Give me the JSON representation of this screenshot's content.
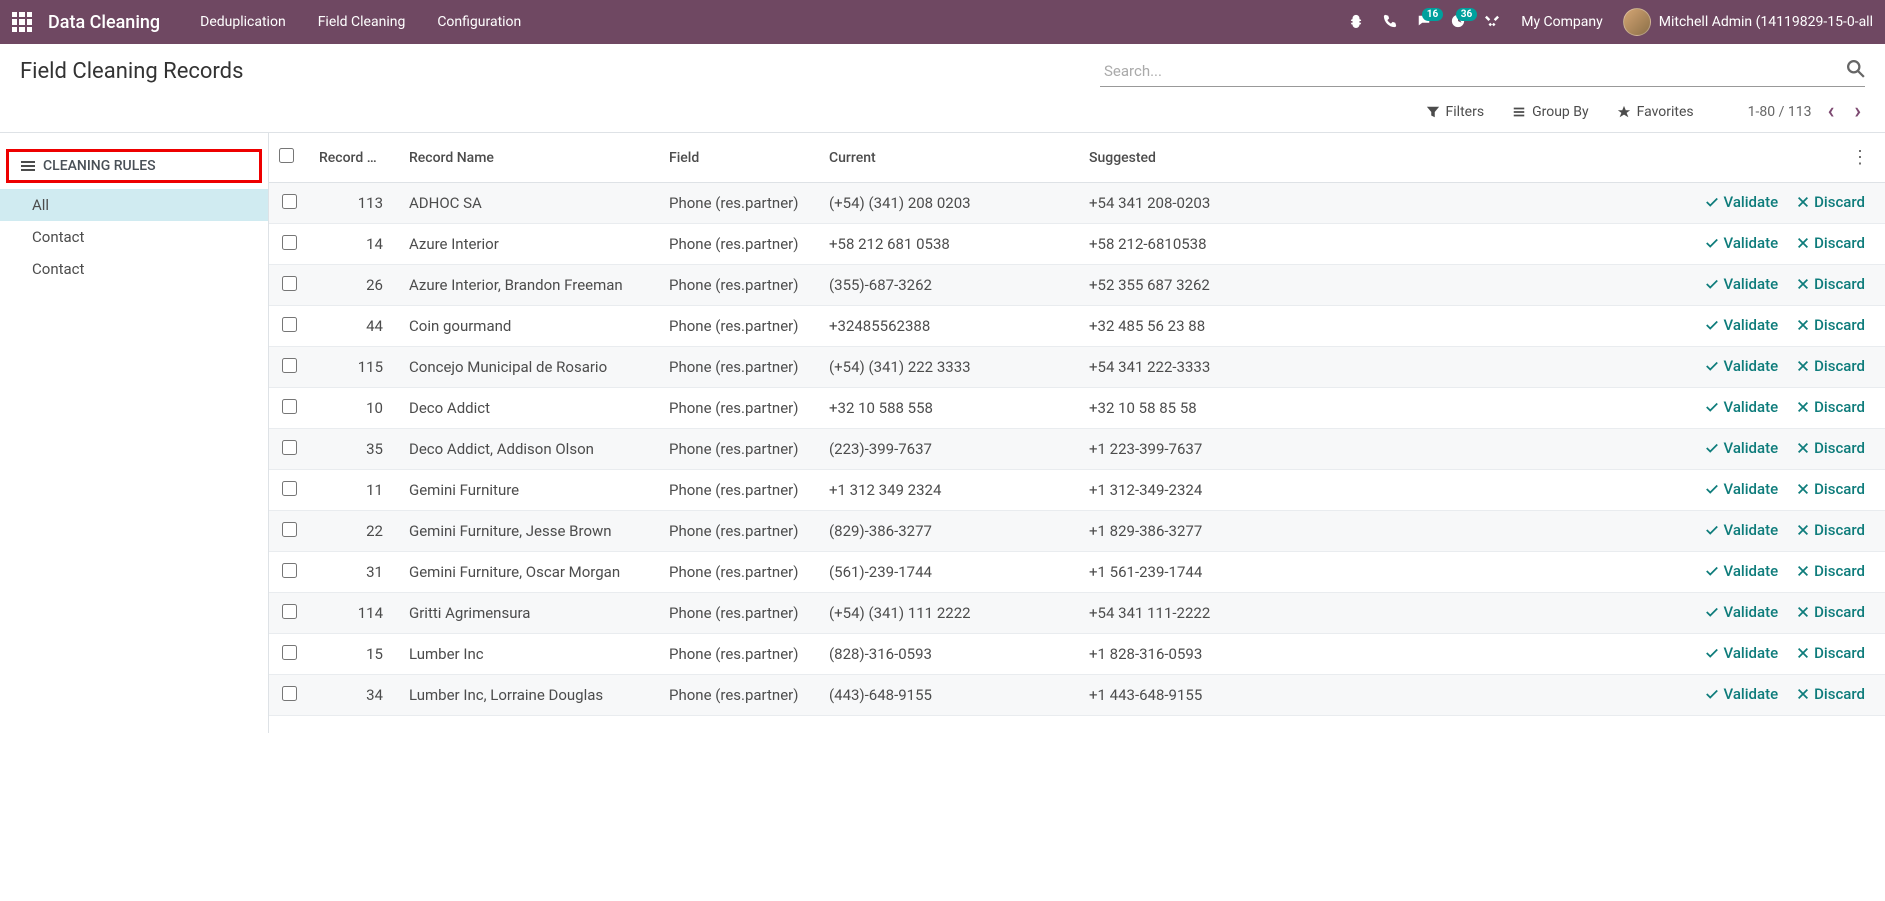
{
  "navbar": {
    "app_title": "Data Cleaning",
    "menu": [
      "Deduplication",
      "Field Cleaning",
      "Configuration"
    ],
    "messages_badge": "16",
    "activities_badge": "36",
    "company": "My Company",
    "user": "Mitchell Admin (14119829-15-0-all"
  },
  "control": {
    "page_title": "Field Cleaning Records",
    "search_placeholder": "Search...",
    "filters_label": "Filters",
    "groupby_label": "Group By",
    "favorites_label": "Favorites",
    "pager": "1-80 / 113"
  },
  "sidebar": {
    "header": "CLEANING RULES",
    "items": [
      {
        "label": "All",
        "active": true
      },
      {
        "label": "Contact",
        "active": false
      },
      {
        "label": "Contact",
        "active": false
      }
    ]
  },
  "table": {
    "headers": {
      "record_id": "Record …",
      "record_name": "Record Name",
      "field": "Field",
      "current": "Current",
      "suggested": "Suggested"
    },
    "actions": {
      "validate": "Validate",
      "discard": "Discard"
    },
    "rows": [
      {
        "id": "113",
        "name": "ADHOC SA",
        "field": "Phone (res.partner)",
        "current": "(+54) (341) 208 0203",
        "suggested": "+54 341 208-0203"
      },
      {
        "id": "14",
        "name": "Azure Interior",
        "field": "Phone (res.partner)",
        "current": "+58 212 681 0538",
        "suggested": "+58 212-6810538"
      },
      {
        "id": "26",
        "name": "Azure Interior, Brandon Freeman",
        "field": "Phone (res.partner)",
        "current": "(355)-687-3262",
        "suggested": "+52 355 687 3262"
      },
      {
        "id": "44",
        "name": "Coin gourmand",
        "field": "Phone (res.partner)",
        "current": "+32485562388",
        "suggested": "+32 485 56 23 88"
      },
      {
        "id": "115",
        "name": "Concejo Municipal de Rosario",
        "field": "Phone (res.partner)",
        "current": "(+54) (341) 222 3333",
        "suggested": "+54 341 222-3333"
      },
      {
        "id": "10",
        "name": "Deco Addict",
        "field": "Phone (res.partner)",
        "current": "+32 10 588 558",
        "suggested": "+32 10 58 85 58"
      },
      {
        "id": "35",
        "name": "Deco Addict, Addison Olson",
        "field": "Phone (res.partner)",
        "current": "(223)-399-7637",
        "suggested": "+1 223-399-7637"
      },
      {
        "id": "11",
        "name": "Gemini Furniture",
        "field": "Phone (res.partner)",
        "current": "+1 312 349 2324",
        "suggested": "+1 312-349-2324"
      },
      {
        "id": "22",
        "name": "Gemini Furniture, Jesse Brown",
        "field": "Phone (res.partner)",
        "current": "(829)-386-3277",
        "suggested": "+1 829-386-3277"
      },
      {
        "id": "31",
        "name": "Gemini Furniture, Oscar Morgan",
        "field": "Phone (res.partner)",
        "current": "(561)-239-1744",
        "suggested": "+1 561-239-1744"
      },
      {
        "id": "114",
        "name": "Gritti Agrimensura",
        "field": "Phone (res.partner)",
        "current": "(+54) (341) 111 2222",
        "suggested": "+54 341 111-2222"
      },
      {
        "id": "15",
        "name": "Lumber Inc",
        "field": "Phone (res.partner)",
        "current": "(828)-316-0593",
        "suggested": "+1 828-316-0593"
      },
      {
        "id": "34",
        "name": "Lumber Inc, Lorraine Douglas",
        "field": "Phone (res.partner)",
        "current": "(443)-648-9155",
        "suggested": "+1 443-648-9155"
      }
    ]
  }
}
